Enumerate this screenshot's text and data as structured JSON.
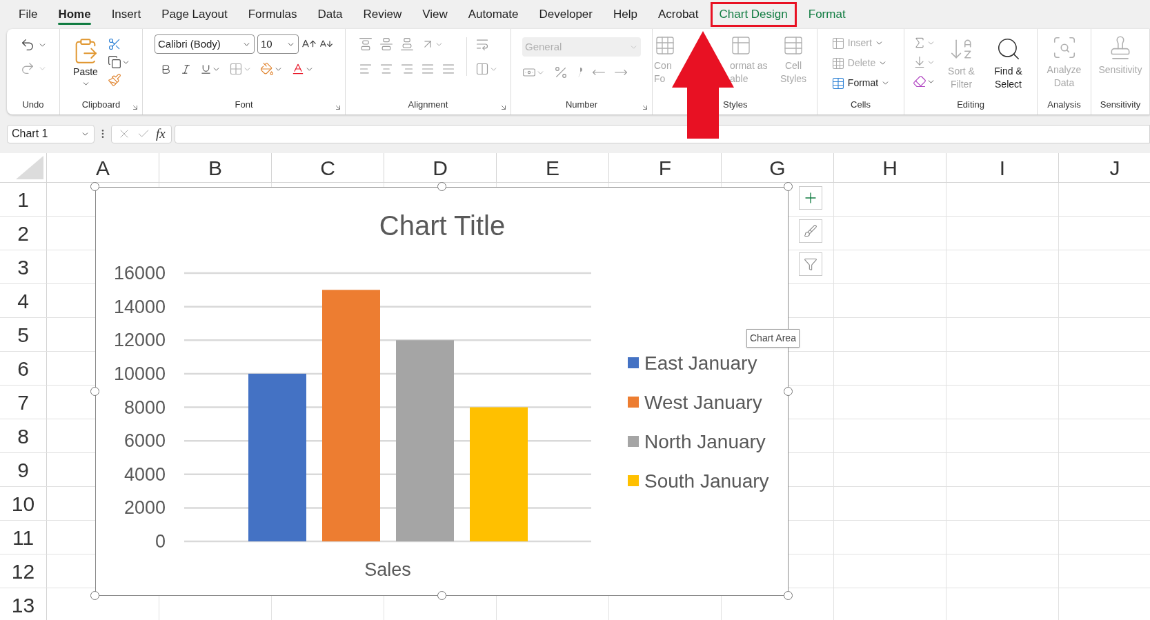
{
  "tabs": [
    {
      "label": "File",
      "selected": false,
      "contextual": false,
      "highlighted": false
    },
    {
      "label": "Home",
      "selected": true,
      "contextual": false,
      "highlighted": false
    },
    {
      "label": "Insert",
      "selected": false,
      "contextual": false,
      "highlighted": false
    },
    {
      "label": "Page Layout",
      "selected": false,
      "contextual": false,
      "highlighted": false
    },
    {
      "label": "Formulas",
      "selected": false,
      "contextual": false,
      "highlighted": false
    },
    {
      "label": "Data",
      "selected": false,
      "contextual": false,
      "highlighted": false
    },
    {
      "label": "Review",
      "selected": false,
      "contextual": false,
      "highlighted": false
    },
    {
      "label": "View",
      "selected": false,
      "contextual": false,
      "highlighted": false
    },
    {
      "label": "Automate",
      "selected": false,
      "contextual": false,
      "highlighted": false
    },
    {
      "label": "Developer",
      "selected": false,
      "contextual": false,
      "highlighted": false
    },
    {
      "label": "Help",
      "selected": false,
      "contextual": false,
      "highlighted": false
    },
    {
      "label": "Acrobat",
      "selected": false,
      "contextual": false,
      "highlighted": false
    },
    {
      "label": "Chart Design",
      "selected": false,
      "contextual": true,
      "highlighted": true
    },
    {
      "label": "Format",
      "selected": false,
      "contextual": true,
      "highlighted": false
    }
  ],
  "ribbon": {
    "groups": [
      {
        "kind": "undo",
        "label": "Undo"
      },
      {
        "kind": "clipboard",
        "label": "Clipboard",
        "paste": "Paste"
      },
      {
        "kind": "font",
        "label": "Font",
        "font_name": "Calibri (Body)",
        "font_size": "10"
      },
      {
        "kind": "alignment",
        "label": "Alignment"
      },
      {
        "kind": "number",
        "label": "Number",
        "format": "General",
        "disabled": true
      },
      {
        "kind": "styles",
        "label": "Styles",
        "buttons": [
          {
            "lines": [
              "Con",
              "Fo"
            ],
            "disabled": true
          },
          {
            "lines": [
              "ormat as",
              "able"
            ],
            "disabled": true
          },
          {
            "lines": [
              "Cell",
              "Styles"
            ],
            "disabled": true
          }
        ]
      },
      {
        "kind": "cells",
        "label": "Cells",
        "buttons": [
          {
            "lines": [
              "Insert"
            ],
            "disabled": true
          },
          {
            "lines": [
              "Delete"
            ],
            "disabled": true
          },
          {
            "lines": [
              "Format"
            ],
            "disabled": false
          }
        ]
      },
      {
        "kind": "editing",
        "label": "Editing",
        "buttons": [
          {
            "lines": [
              "Sort &",
              "Filter"
            ],
            "disabled": true
          },
          {
            "lines": [
              "Find &",
              "Select"
            ],
            "disabled": false
          }
        ]
      },
      {
        "kind": "analysis",
        "label": "Analysis",
        "buttons": [
          {
            "lines": [
              "Analyze",
              "Data"
            ],
            "disabled": true
          }
        ]
      },
      {
        "kind": "sensitivity",
        "label": "Sensitivity",
        "buttons": [
          {
            "lines": [
              "Sensitivity"
            ],
            "disabled": true
          }
        ]
      }
    ]
  },
  "formula_bar": {
    "name_box": "Chart 1",
    "fx": "fx"
  },
  "grid": {
    "columns": [
      "A",
      "B",
      "C",
      "D",
      "E",
      "F",
      "G",
      "H",
      "I",
      "J"
    ],
    "rows": [
      "1",
      "2",
      "3",
      "4",
      "5",
      "6",
      "7",
      "8",
      "9",
      "10",
      "11",
      "12",
      "13"
    ]
  },
  "chart": {
    "tooltip": "Chart Area",
    "chart_data": {
      "type": "bar",
      "title": "Chart Title",
      "categories": [
        "Sales"
      ],
      "series": [
        {
          "name": "East January",
          "color": "#4472c4",
          "values": [
            10000
          ]
        },
        {
          "name": "West January",
          "color": "#ed7d31",
          "values": [
            15000
          ]
        },
        {
          "name": "North January",
          "color": "#a5a5a5",
          "values": [
            12000
          ]
        },
        {
          "name": "South January",
          "color": "#ffc000",
          "values": [
            8000
          ]
        }
      ],
      "ylim": [
        0,
        16000
      ],
      "yticks": [
        0,
        2000,
        4000,
        6000,
        8000,
        10000,
        12000,
        14000,
        16000
      ],
      "grid": true,
      "legend": true
    }
  }
}
